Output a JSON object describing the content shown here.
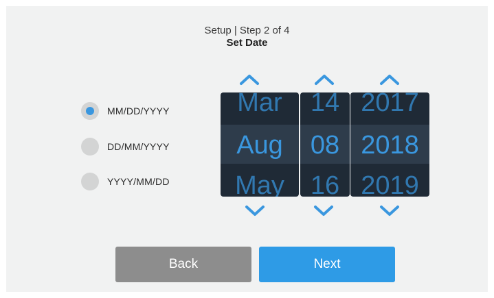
{
  "header": {
    "step": "Setup | Step 2 of 4",
    "title": "Set Date"
  },
  "formats": [
    {
      "label": "MM/DD/YYYY",
      "selected": true
    },
    {
      "label": "DD/MM/YYYY",
      "selected": false
    },
    {
      "label": "YYYY/MM/DD",
      "selected": false
    }
  ],
  "picker": {
    "month": {
      "prev": "Mar",
      "current": "Aug",
      "next": "May"
    },
    "day": {
      "prev": "14",
      "current": "08",
      "next": "16"
    },
    "year": {
      "prev": "2017",
      "current": "2018",
      "next": "2019"
    }
  },
  "buttons": {
    "back": "Back",
    "next": "Next"
  },
  "colors": {
    "accent": "#3a97df",
    "picker_bg": "#1f2a36",
    "back_btn": "#8d8d8d",
    "next_btn": "#2e9be6"
  },
  "icons": {
    "up": "chevron-up-icon",
    "down": "chevron-down-icon"
  }
}
